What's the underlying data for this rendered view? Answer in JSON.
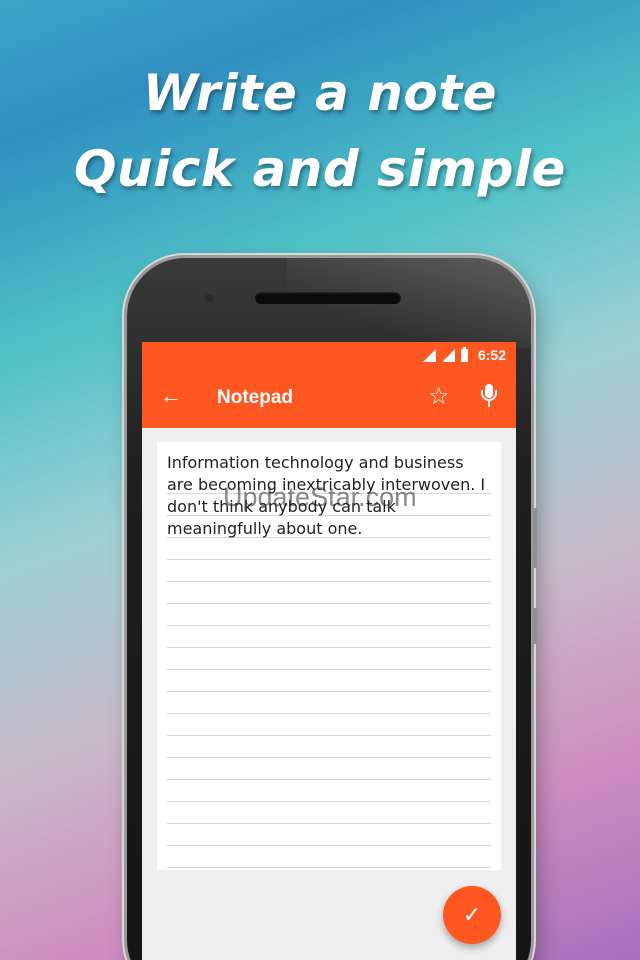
{
  "promo": {
    "line1": "Write a note",
    "line2": "Quick and simple"
  },
  "statusbar": {
    "time": "6:52",
    "icons": [
      "signal-icon",
      "signal-icon",
      "battery-icon"
    ]
  },
  "appbar": {
    "title": "Notepad",
    "back_icon": "←",
    "star_icon": "☆",
    "mic_icon": "mic-icon",
    "color": "#ff5722"
  },
  "note": {
    "text": "Information technology and business are becoming inextricably interwoven. I don't think anybody can talk meaningfully about one."
  },
  "watermark": {
    "text": "UpdateStar.com"
  },
  "fab": {
    "icon": "✓"
  }
}
